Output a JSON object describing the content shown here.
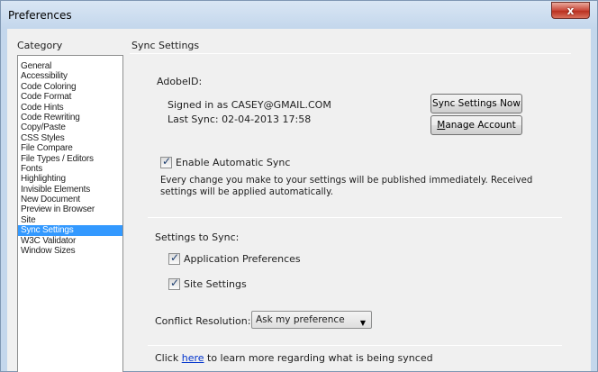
{
  "window": {
    "title": "Preferences",
    "close_glyph": "x"
  },
  "category": {
    "label": "Category",
    "items": [
      "General",
      "Accessibility",
      "Code Coloring",
      "Code Format",
      "Code Hints",
      "Code Rewriting",
      "Copy/Paste",
      "CSS Styles",
      "File Compare",
      "File Types / Editors",
      "Fonts",
      "Highlighting",
      "Invisible Elements",
      "New Document",
      "Preview in Browser",
      "Site",
      "Sync Settings",
      "W3C Validator",
      "Window Sizes"
    ],
    "selected": "Sync Settings"
  },
  "sync": {
    "section_title": "Sync Settings",
    "adobe_id_label": "AdobeID:",
    "signed_in_text": "Signed in as CASEY@GMAIL.COM",
    "last_sync_text": "Last Sync: 02-04-2013 17:58",
    "sync_now_button": "Sync Settings Now",
    "manage_account_button": "Manage Account",
    "enable_auto_sync_label": "Enable Automatic Sync",
    "enable_auto_sync_checked": true,
    "auto_sync_description_line1": "Every change you make to your settings will be published immediately. Received",
    "auto_sync_description_line2": "settings will be applied automatically.",
    "settings_to_sync_label": "Settings to Sync:",
    "app_prefs_label": "Application Preferences",
    "app_prefs_checked": true,
    "site_settings_label": "Site Settings",
    "site_settings_checked": true,
    "conflict_resolution_label": "Conflict Resolution:",
    "conflict_resolution_value": "Ask my preference",
    "footer_prefix": "Click ",
    "footer_link": "here",
    "footer_suffix": " to learn more regarding what is being synced"
  },
  "icons": {
    "check": "✓",
    "dropdown": "▼"
  }
}
